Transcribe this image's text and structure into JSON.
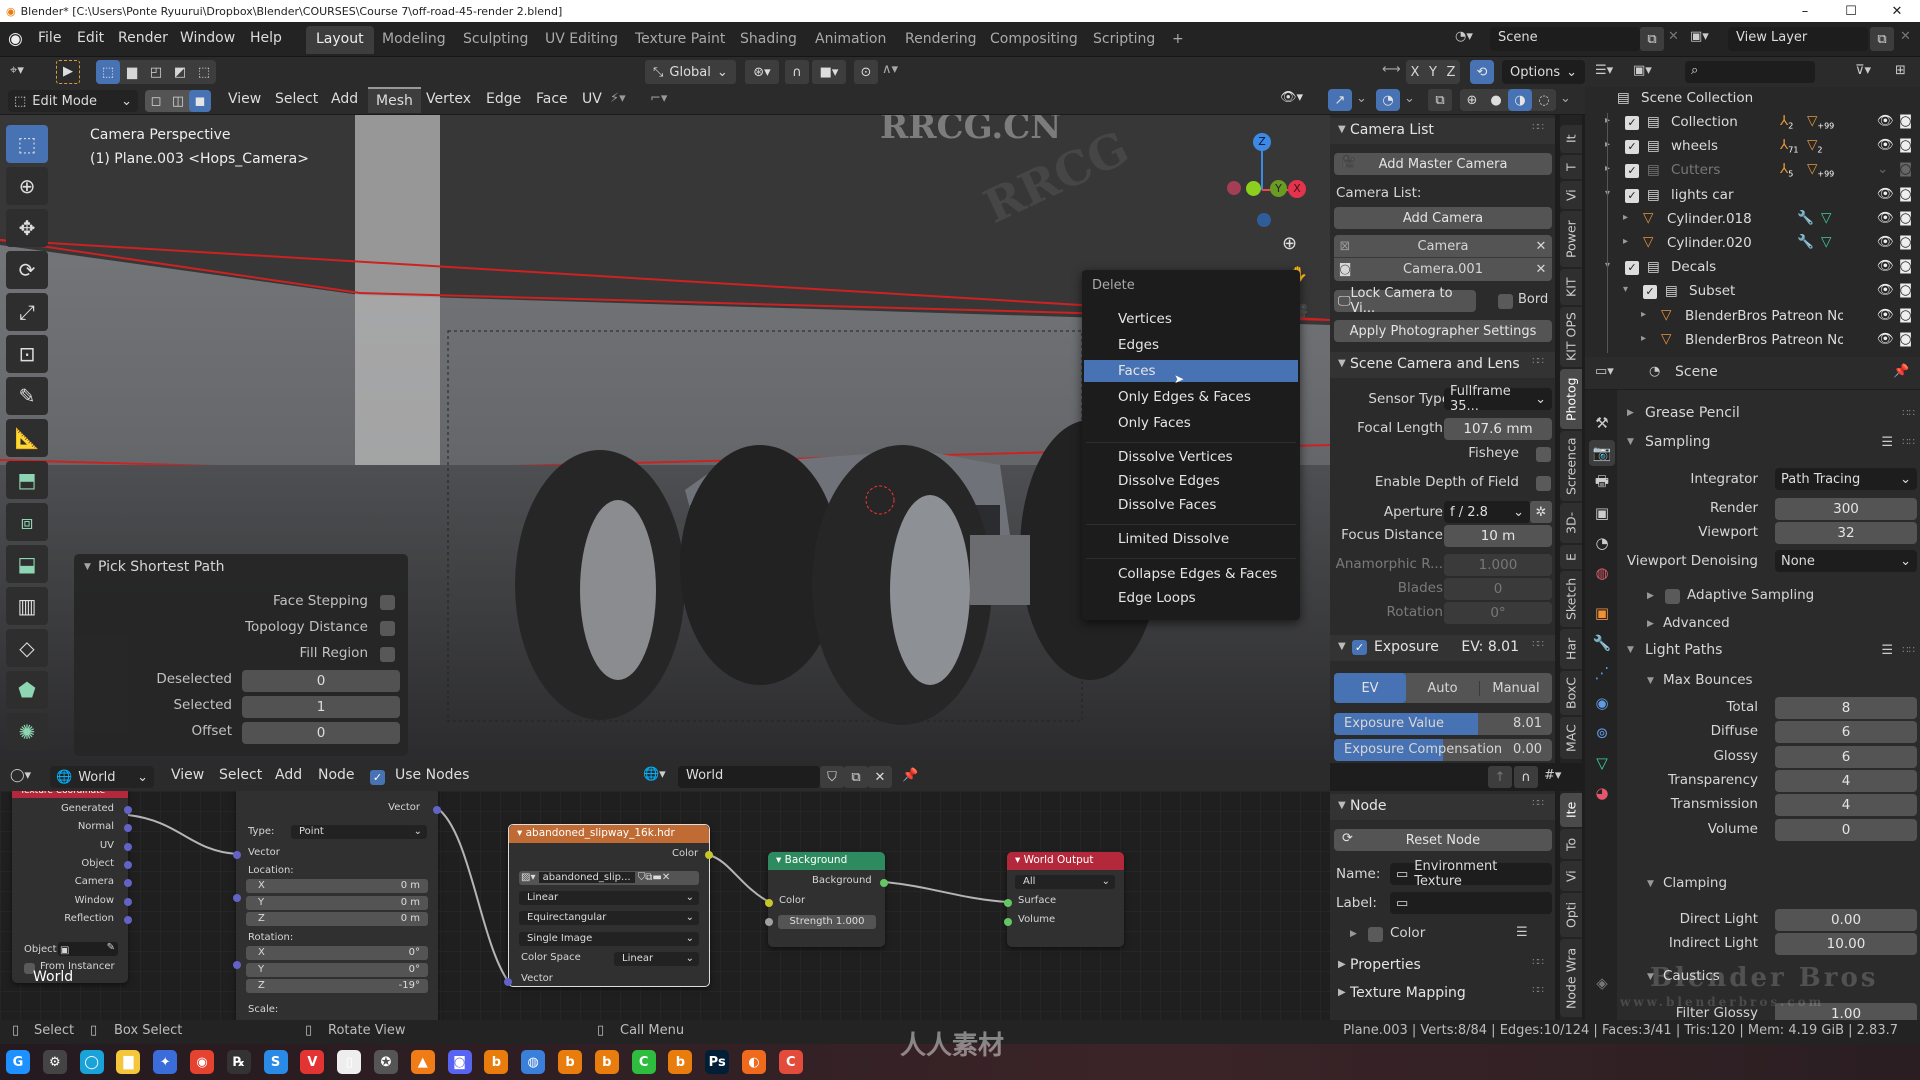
{
  "window": {
    "title": "Blender* [C:\\Users\\Ponte Ryuurui\\Dropbox\\Blender\\COURSES\\Course 7\\off-road-45-render 2.blend]",
    "controls": [
      "–",
      "☐",
      "✕"
    ]
  },
  "menu": {
    "items": [
      "File",
      "Edit",
      "Render",
      "Window",
      "Help"
    ]
  },
  "workspaces": {
    "tabs": [
      "Layout",
      "Modeling",
      "Sculpting",
      "UV Editing",
      "Texture Paint",
      "Shading",
      "Animation",
      "Rendering",
      "Compositing",
      "Scripting"
    ],
    "active": "Layout",
    "add": "+"
  },
  "scene_selector": {
    "value": "Scene"
  },
  "view_layer_selector": {
    "value": "View Layer"
  },
  "tool_header": {
    "transform_orientation": "Global",
    "axes": [
      "X",
      "Y",
      "Z"
    ],
    "options": "Options"
  },
  "mode_header": {
    "mode": "Edit Mode",
    "menus": [
      "View",
      "Select",
      "Add",
      "Mesh",
      "Vertex",
      "Edge",
      "Face",
      "UV"
    ],
    "active_menu": "Mesh"
  },
  "viewport": {
    "view_name": "Camera Perspective",
    "object_info": "(1) Plane.003 <Hops_Camera>",
    "gizmo": {
      "z": "Z",
      "y": "Y",
      "x": "X"
    },
    "watermark": "RRCG.CN"
  },
  "delete_menu": {
    "title": "Delete",
    "groups": [
      [
        "Vertices",
        "Edges",
        "Faces",
        "Only Edges & Faces",
        "Only Faces"
      ],
      [
        "Dissolve Vertices",
        "Dissolve Edges",
        "Dissolve Faces"
      ],
      [
        "Limited Dissolve"
      ],
      [
        "Collapse Edges & Faces",
        "Edge Loops"
      ]
    ],
    "highlighted": "Faces"
  },
  "redo_panel": {
    "title": "Pick Shortest Path",
    "checkboxes": [
      {
        "label": "Face Stepping",
        "checked": false
      },
      {
        "label": "Topology Distance",
        "checked": false
      },
      {
        "label": "Fill Region",
        "checked": false
      }
    ],
    "fields": [
      {
        "label": "Deselected",
        "value": "0"
      },
      {
        "label": "Selected",
        "value": "1"
      },
      {
        "label": "Offset",
        "value": "0"
      }
    ]
  },
  "npanel": {
    "camera_list": {
      "title": "Camera List",
      "add_master": "Add Master Camera",
      "list_label": "Camera List:",
      "add_camera": "Add Camera",
      "cameras": [
        "Camera",
        "Camera.001"
      ],
      "lock_camera": "Lock Camera to Vi...",
      "border_label": "Bord",
      "apply_settings": "Apply Photographer Settings"
    },
    "scene_camera": {
      "title": "Scene Camera and Lens",
      "sensor_type": {
        "label": "Sensor Type",
        "value": "Fullframe 35..."
      },
      "focal_length": {
        "label": "Focal Length",
        "value": "107.6 mm"
      },
      "fisheye": {
        "label": "Fisheye",
        "checked": false
      },
      "dof": {
        "label": "Enable Depth of Field",
        "checked": false
      },
      "aperture": {
        "label": "Aperture",
        "value": "f / 2.8"
      },
      "focus_distance": {
        "label": "Focus Distance",
        "value": "10 m"
      },
      "anamorphic": {
        "label": "Anamorphic R...",
        "value": "1.000"
      },
      "blades": {
        "label": "Blades",
        "value": "0"
      },
      "rotation": {
        "label": "Rotation",
        "value": "0°"
      }
    },
    "exposure": {
      "title": "Exposure",
      "ev_readout": "EV: 8.01",
      "enabled": true,
      "modes": [
        "EV",
        "Auto",
        "Manual"
      ],
      "active_mode": "EV",
      "exposure_value": {
        "label": "Exposure Value",
        "value": "8.01",
        "fill": 0.66
      },
      "exposure_comp": {
        "label": "Exposure Compensation",
        "value": "0.00",
        "fill": 0.5
      }
    },
    "tabs_top": [
      "It",
      "T",
      "Vi",
      "Power",
      "KIT",
      "KIT OPS",
      "Photog",
      "Screenca",
      "3D-",
      "E",
      "Sketch",
      "Har",
      "BoxC",
      "MAC"
    ],
    "active_tab_top": "Photog"
  },
  "node_npanel": {
    "node_title": "Node",
    "reset": "Reset Node",
    "name_label": "Name:",
    "name_value": "Environment Texture",
    "label_label": "Label:",
    "label_value": "",
    "color_label": "Color",
    "properties": "Properties",
    "texture_mapping": "Texture Mapping",
    "tabs": [
      "Ite",
      "To",
      "Vi",
      "Opti",
      "Node Wra"
    ],
    "active_tab": "Ite"
  },
  "outliner": {
    "root": "Scene Collection",
    "rows": [
      {
        "name": "Collection",
        "indent": 1,
        "expand": "▸",
        "type": "collection",
        "checked": true,
        "badges": [
          "2",
          "+99"
        ]
      },
      {
        "name": "wheels",
        "indent": 1,
        "expand": "▸",
        "type": "collection",
        "checked": true,
        "badges": [
          "71",
          "2"
        ]
      },
      {
        "name": "Cutters",
        "indent": 1,
        "expand": "▸",
        "type": "collection",
        "checked": true,
        "dim": true,
        "badges": [
          "5",
          "+99"
        ]
      },
      {
        "name": "lights car",
        "indent": 1,
        "expand": "▾",
        "type": "collection",
        "checked": true,
        "badges": []
      },
      {
        "name": "Cylinder.018",
        "indent": 2,
        "expand": "▸",
        "type": "mesh",
        "badges": []
      },
      {
        "name": "Cylinder.020",
        "indent": 2,
        "expand": "▸",
        "type": "mesh",
        "badges": []
      },
      {
        "name": "Decals",
        "indent": 1,
        "expand": "▾",
        "type": "collection",
        "checked": true,
        "badges": []
      },
      {
        "name": "Subset",
        "indent": 2,
        "expand": "▾",
        "type": "collection",
        "checked": true,
        "badges": []
      },
      {
        "name": "BlenderBros Patreon Nov",
        "indent": 3,
        "expand": "▸",
        "type": "mesh",
        "badges": []
      },
      {
        "name": "BlenderBros Patreon Nov",
        "indent": 3,
        "expand": "▸",
        "type": "mesh",
        "badges": []
      }
    ]
  },
  "properties": {
    "context": "Scene",
    "sections": {
      "grease_pencil": "Grease Pencil",
      "sampling": "Sampling",
      "integrator": {
        "label": "Integrator",
        "value": "Path Tracing"
      },
      "render": {
        "label": "Render",
        "value": "300"
      },
      "viewport": {
        "label": "Viewport",
        "value": "32"
      },
      "denoising": {
        "label": "Viewport Denoising",
        "value": "None"
      },
      "adaptive": "Adaptive Sampling",
      "advanced": "Advanced",
      "light_paths": "Light Paths",
      "max_bounces": "Max Bounces",
      "bounces": [
        {
          "label": "Total",
          "value": "8"
        },
        {
          "label": "Diffuse",
          "value": "6"
        },
        {
          "label": "Glossy",
          "value": "6"
        },
        {
          "label": "Transparency",
          "value": "4"
        },
        {
          "label": "Transmission",
          "value": "4"
        },
        {
          "label": "Volume",
          "value": "0"
        }
      ],
      "clamping": "Clamping",
      "direct_light": {
        "label": "Direct Light",
        "value": "0.00"
      },
      "indirect_light": {
        "label": "Indirect Light",
        "value": "10.00"
      },
      "caustics": "Caustics",
      "filter_glossy": {
        "label": "Filter Glossy",
        "value": "1.00"
      }
    }
  },
  "node_editor": {
    "header": {
      "editor_type": "World",
      "menus": [
        "View",
        "Select",
        "Add",
        "Node"
      ],
      "use_nodes": "Use Nodes",
      "world_name": "World"
    },
    "tree_label": "World",
    "nodes": {
      "texcoord": {
        "title": "Texture Coordinate",
        "outputs": [
          "Generated",
          "Normal",
          "UV",
          "Object",
          "Camera",
          "Window",
          "Reflection"
        ],
        "object_label": "Object",
        "from_instancer": "From Instancer"
      },
      "mapping": {
        "output": "Vector",
        "type_label": "Type:",
        "type_value": "Point",
        "vector": "Vector",
        "location": "Location:",
        "loc": [
          [
            "X",
            "0 m"
          ],
          [
            "Y",
            "0 m"
          ],
          [
            "Z",
            "0 m"
          ]
        ],
        "rotation": "Rotation:",
        "rot": [
          [
            "X",
            "0°"
          ],
          [
            "Y",
            "0°"
          ],
          [
            "Z",
            "-19°"
          ]
        ],
        "scale": "Scale:"
      },
      "envtex": {
        "title": "abandoned_slipway_16k.hdr",
        "output": "Color",
        "image": "abandoned_slip...",
        "interp": "Linear",
        "projection": "Equirectangular",
        "source": "Single Image",
        "colorspace_label": "Color Space",
        "colorspace": "Linear",
        "input": "Vector"
      },
      "background": {
        "title": "Background",
        "output": "Background",
        "color": "Color",
        "strength": "Strength",
        "strength_value": "1.000"
      },
      "output": {
        "title": "World Output",
        "target": "All",
        "surface": "Surface",
        "volume": "Volume"
      }
    }
  },
  "statusbar": {
    "hints": [
      "Select",
      "Box Select",
      "Rotate View",
      "Call Menu"
    ],
    "stats": "Plane.003 | Verts:8/84 | Edges:10/124 | Faces:3/41 | Tris:120 | Mem: 4.19 GiB | 2.83.7"
  },
  "taskbar": {
    "apps": [
      "G",
      "⚙",
      "◯",
      "▇",
      "✦",
      "◉",
      "℞",
      "S",
      "V",
      "▯",
      "✪",
      "▲",
      "◙",
      "b",
      "◍",
      "b",
      "b",
      "C",
      "b",
      "Ps",
      "◐",
      "C"
    ]
  },
  "watermarks": [
    "RRCG",
    "人人素材",
    "Blender Bros",
    "www.blenderbros.com"
  ]
}
